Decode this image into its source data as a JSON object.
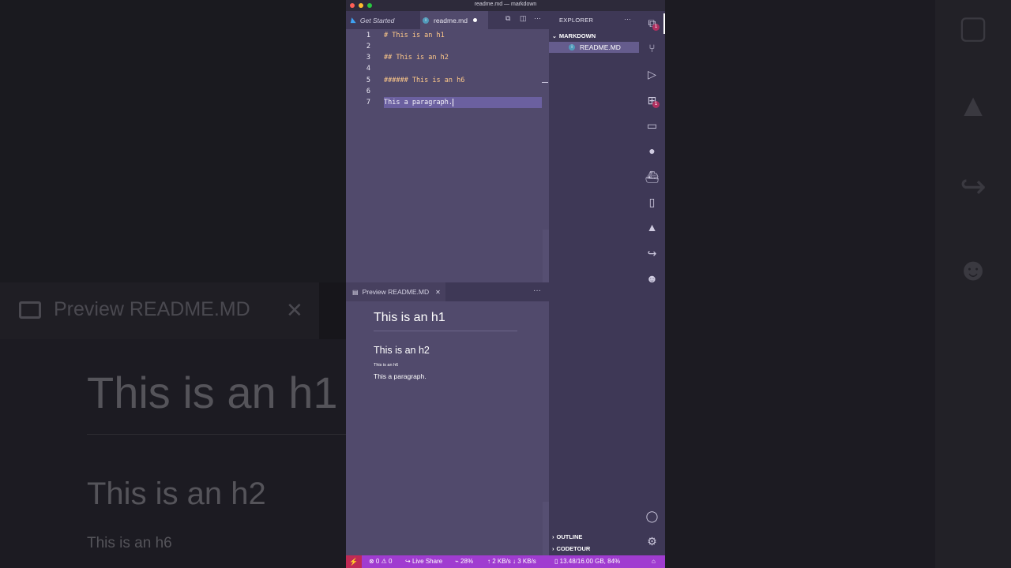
{
  "background": {
    "preview_title": "Preview README.MD",
    "close": "✕",
    "h1": "This is an h1",
    "h2": "This is an h2",
    "h6": "This is an h6"
  },
  "window": {
    "title": "readme.md — markdown"
  },
  "tabs": [
    {
      "label": "Get Started",
      "icon": "vscode-icon"
    },
    {
      "label": "readme.md",
      "icon": "info-icon",
      "dirty": true
    }
  ],
  "editor": {
    "lines": [
      {
        "num": "1",
        "text": "# This is an h1"
      },
      {
        "num": "2",
        "text": ""
      },
      {
        "num": "3",
        "text": "## This is an h2"
      },
      {
        "num": "4",
        "text": ""
      },
      {
        "num": "5",
        "text": "###### This is an h6"
      },
      {
        "num": "6",
        "text": ""
      },
      {
        "num": "7",
        "text": "This a paragraph."
      }
    ]
  },
  "preview": {
    "tab_label": "Preview README.MD",
    "more": "···",
    "h1": "This is an h1",
    "h2": "This is an h2",
    "h6": "This is an h6",
    "paragraph": "This a paragraph."
  },
  "sidebar": {
    "title": "EXPLORER",
    "more": "···",
    "folder": "MARKDOWN",
    "file": "README.MD",
    "outline": "OUTLINE",
    "codetour": "CODETOUR"
  },
  "activity": {
    "explorer_badge": "1",
    "extensions_badge": "1"
  },
  "status": {
    "remote": "⚡",
    "problems": "⊗ 0 ⚠ 0",
    "live_share": "Live Share",
    "cpu": "28%",
    "network": "↑ 2 KB/s ↓ 3 KB/s",
    "memory": "13.48/16.00 GB, 84%"
  },
  "colors": {
    "editor_bg": "#514a6c",
    "sidebar_bg": "#3e3856",
    "statusbar_bg": "#a03cd0",
    "heading_syntax": "#ffc98a"
  }
}
